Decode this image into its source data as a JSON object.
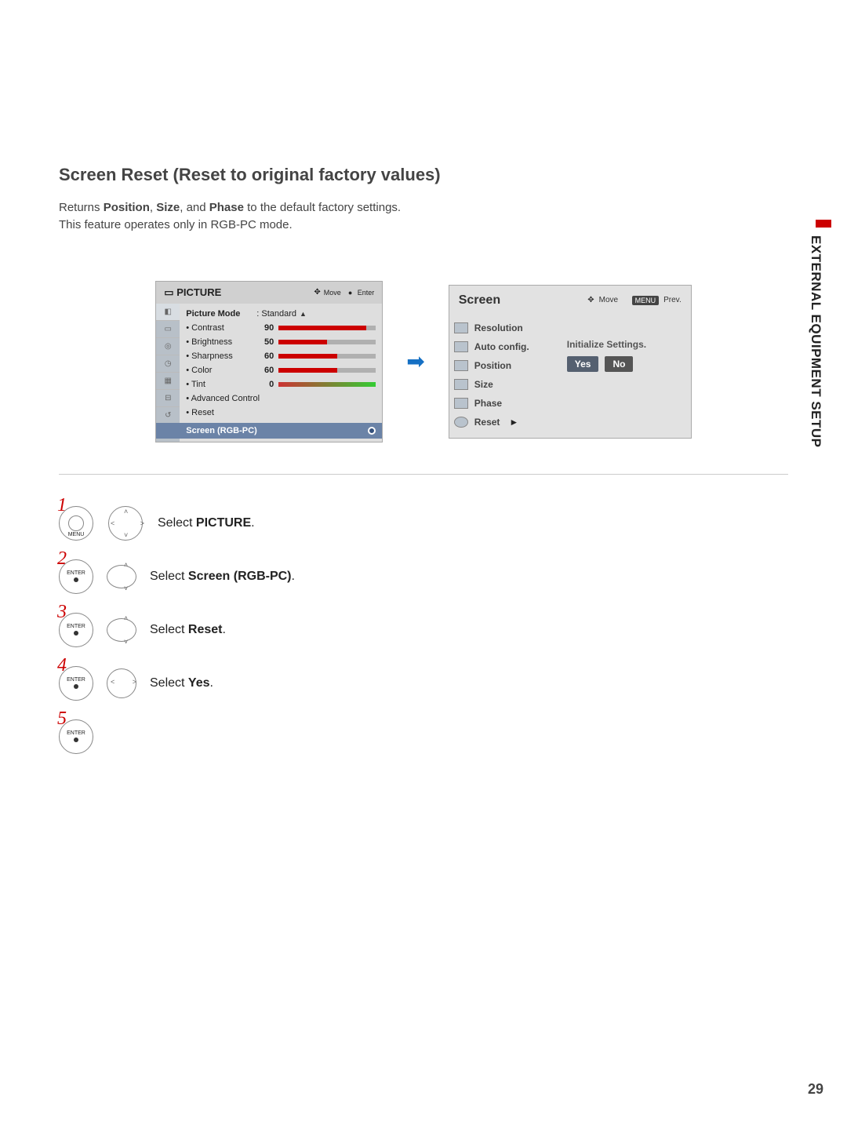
{
  "side_label": "EXTERNAL EQUIPMENT SETUP",
  "page_number": "29",
  "heading": "Screen Reset (Reset to original factory values)",
  "sub_line1_a": "Returns ",
  "sub_line1_b": "Position",
  "sub_line1_c": ", ",
  "sub_line1_d": "Size",
  "sub_line1_e": ", and ",
  "sub_line1_f": "Phase",
  "sub_line1_g": " to the default factory settings.",
  "sub_line2": "This feature operates only in RGB-PC mode.",
  "picture_menu": {
    "title": "PICTURE",
    "move": "Move",
    "enter": "Enter",
    "picture_mode_label": "Picture Mode",
    "picture_mode_value": ": Standard",
    "contrast_label": "• Contrast",
    "contrast_val": "90",
    "brightness_label": "• Brightness",
    "brightness_val": "50",
    "sharpness_label": "• Sharpness",
    "sharpness_val": "60",
    "color_label": "• Color",
    "color_val": "60",
    "tint_label": "• Tint",
    "tint_val": "0",
    "advanced": "• Advanced Control",
    "reset": "• Reset",
    "screen_rgb": "Screen (RGB-PC)"
  },
  "screen_menu": {
    "title": "Screen",
    "move": "Move",
    "menu_badge": "MENU",
    "prev": "Prev.",
    "resolution": "Resolution",
    "auto": "Auto config.",
    "position": "Position",
    "size": "Size",
    "phase": "Phase",
    "reset": "Reset",
    "initialize": "Initialize Settings.",
    "yes": "Yes",
    "no": "No"
  },
  "steps": {
    "s1_num": "1",
    "s1_btn": "MENU",
    "s1_a": "Select ",
    "s1_b": "PICTURE",
    "s1_c": ".",
    "s2_num": "2",
    "s2_btn": "ENTER",
    "s2_a": "Select ",
    "s2_b": "Screen (RGB-PC)",
    "s2_c": ".",
    "s3_num": "3",
    "s3_btn": "ENTER",
    "s3_a": "Select ",
    "s3_b": "Reset",
    "s3_c": ".",
    "s4_num": "4",
    "s4_btn": "ENTER",
    "s4_a": "Select ",
    "s4_b": "Yes",
    "s4_c": ".",
    "s5_num": "5",
    "s5_btn": "ENTER"
  }
}
